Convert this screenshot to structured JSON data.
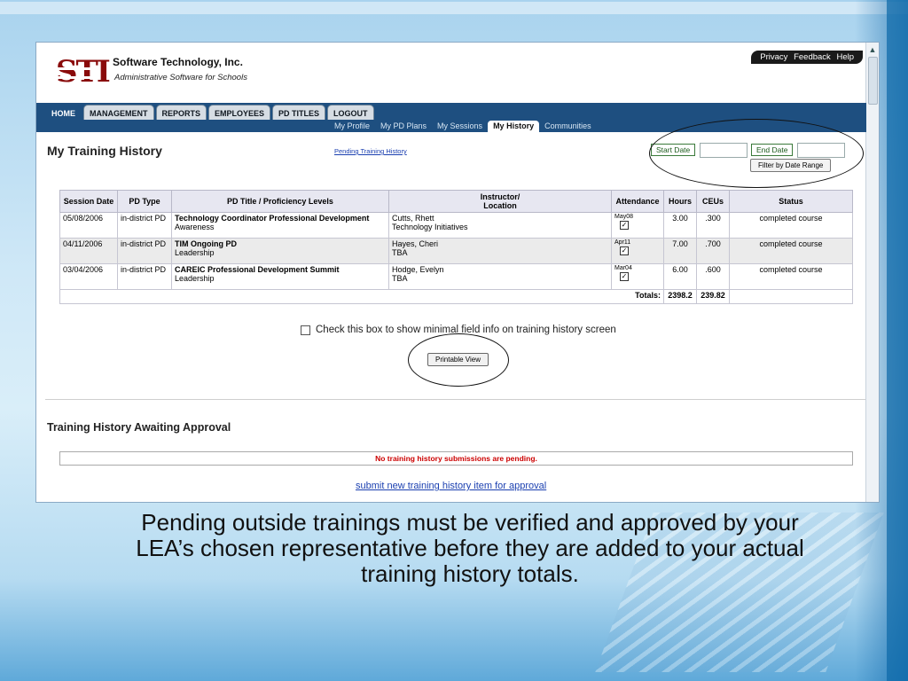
{
  "header": {
    "company": "Software Technology, Inc.",
    "tagline": "Administrative Software for Schools",
    "logo_text": "STI",
    "top_links": [
      "Privacy",
      "Feedback",
      "Help"
    ]
  },
  "nav": {
    "tabs": [
      "HOME",
      "MANAGEMENT",
      "REPORTS",
      "EMPLOYEES",
      "PD TITLES",
      "LOGOUT"
    ],
    "active_tab": "HOME",
    "subtabs": [
      "My Profile",
      "My PD Plans",
      "My Sessions",
      "My History",
      "Communities"
    ],
    "active_subtab": "My History"
  },
  "page": {
    "title": "My Training History",
    "pending_link": "Pending Training History",
    "start_date_label": "Start Date",
    "end_date_label": "End Date",
    "filter_button": "Filter by Date Range"
  },
  "table": {
    "headers": [
      "Session Date",
      "PD Type",
      "PD Title / Proficiency Levels",
      "Instructor/",
      "Location",
      "Attendance",
      "Hours",
      "CEUs",
      "Status"
    ],
    "rows": [
      {
        "date": "05/08/2006",
        "type": "in-district PD",
        "title": "Technology Coordinator Professional Development",
        "level": "Awareness",
        "instructor": "Cutts, Rhett",
        "location": "Technology Initiatives",
        "attendance": "May08",
        "hours": "3.00",
        "ceus": ".300",
        "status": "completed course"
      },
      {
        "date": "04/11/2006",
        "type": "in-district PD",
        "title": "TIM Ongoing PD",
        "level": "Leadership",
        "instructor": "Hayes, Cheri",
        "location": "TBA",
        "attendance": "Apr11",
        "hours": "7.00",
        "ceus": ".700",
        "status": "completed course"
      },
      {
        "date": "03/04/2006",
        "type": "in-district PD",
        "title": "CAREIC Professional Development Summit",
        "level": "Leadership",
        "instructor": "Hodge, Evelyn",
        "location": "TBA",
        "attendance": "Mar04",
        "hours": "6.00",
        "ceus": ".600",
        "status": "completed course"
      }
    ],
    "totals_label": "Totals:",
    "total_hours": "2398.2",
    "total_ceus": "239.82"
  },
  "options": {
    "minimal_checkbox_label": "Check this box to show minimal field info on training history screen",
    "printable_button": "Printable View"
  },
  "awaiting": {
    "title": "Training History Awaiting Approval",
    "no_pending": "No training history submissions are pending.",
    "submit_link": "submit new training history item for approval"
  },
  "caption": {
    "text": "Pending outside trainings must be verified and approved by your LEA’s chosen representative before they are added to your actual training history totals."
  },
  "colors": {
    "nav_bar": "#1e4f80",
    "logo_red": "#8a0b0b",
    "alert_red": "#cc0000",
    "link_blue": "#1a3fb0"
  }
}
